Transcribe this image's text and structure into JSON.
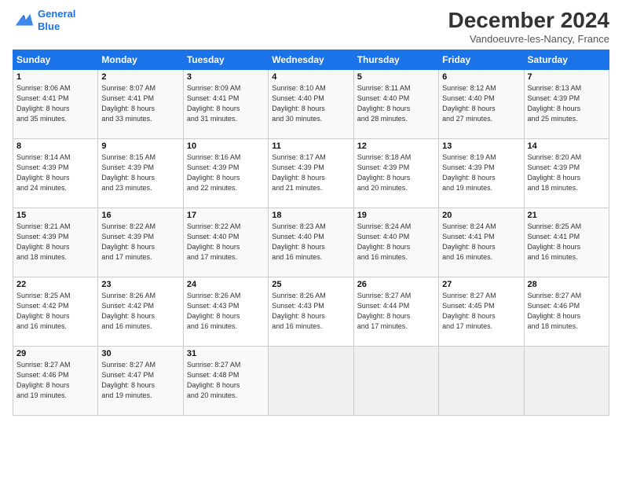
{
  "header": {
    "logo_line1": "General",
    "logo_line2": "Blue",
    "title": "December 2024",
    "subtitle": "Vandoeuvre-les-Nancy, France"
  },
  "weekdays": [
    "Sunday",
    "Monday",
    "Tuesday",
    "Wednesday",
    "Thursday",
    "Friday",
    "Saturday"
  ],
  "weeks": [
    [
      {
        "day": "1",
        "sunrise": "Sunrise: 8:06 AM",
        "sunset": "Sunset: 4:41 PM",
        "daylight": "Daylight: 8 hours and 35 minutes."
      },
      {
        "day": "2",
        "sunrise": "Sunrise: 8:07 AM",
        "sunset": "Sunset: 4:41 PM",
        "daylight": "Daylight: 8 hours and 33 minutes."
      },
      {
        "day": "3",
        "sunrise": "Sunrise: 8:09 AM",
        "sunset": "Sunset: 4:41 PM",
        "daylight": "Daylight: 8 hours and 31 minutes."
      },
      {
        "day": "4",
        "sunrise": "Sunrise: 8:10 AM",
        "sunset": "Sunset: 4:40 PM",
        "daylight": "Daylight: 8 hours and 30 minutes."
      },
      {
        "day": "5",
        "sunrise": "Sunrise: 8:11 AM",
        "sunset": "Sunset: 4:40 PM",
        "daylight": "Daylight: 8 hours and 28 minutes."
      },
      {
        "day": "6",
        "sunrise": "Sunrise: 8:12 AM",
        "sunset": "Sunset: 4:40 PM",
        "daylight": "Daylight: 8 hours and 27 minutes."
      },
      {
        "day": "7",
        "sunrise": "Sunrise: 8:13 AM",
        "sunset": "Sunset: 4:39 PM",
        "daylight": "Daylight: 8 hours and 25 minutes."
      }
    ],
    [
      {
        "day": "8",
        "sunrise": "Sunrise: 8:14 AM",
        "sunset": "Sunset: 4:39 PM",
        "daylight": "Daylight: 8 hours and 24 minutes."
      },
      {
        "day": "9",
        "sunrise": "Sunrise: 8:15 AM",
        "sunset": "Sunset: 4:39 PM",
        "daylight": "Daylight: 8 hours and 23 minutes."
      },
      {
        "day": "10",
        "sunrise": "Sunrise: 8:16 AM",
        "sunset": "Sunset: 4:39 PM",
        "daylight": "Daylight: 8 hours and 22 minutes."
      },
      {
        "day": "11",
        "sunrise": "Sunrise: 8:17 AM",
        "sunset": "Sunset: 4:39 PM",
        "daylight": "Daylight: 8 hours and 21 minutes."
      },
      {
        "day": "12",
        "sunrise": "Sunrise: 8:18 AM",
        "sunset": "Sunset: 4:39 PM",
        "daylight": "Daylight: 8 hours and 20 minutes."
      },
      {
        "day": "13",
        "sunrise": "Sunrise: 8:19 AM",
        "sunset": "Sunset: 4:39 PM",
        "daylight": "Daylight: 8 hours and 19 minutes."
      },
      {
        "day": "14",
        "sunrise": "Sunrise: 8:20 AM",
        "sunset": "Sunset: 4:39 PM",
        "daylight": "Daylight: 8 hours and 18 minutes."
      }
    ],
    [
      {
        "day": "15",
        "sunrise": "Sunrise: 8:21 AM",
        "sunset": "Sunset: 4:39 PM",
        "daylight": "Daylight: 8 hours and 18 minutes."
      },
      {
        "day": "16",
        "sunrise": "Sunrise: 8:22 AM",
        "sunset": "Sunset: 4:39 PM",
        "daylight": "Daylight: 8 hours and 17 minutes."
      },
      {
        "day": "17",
        "sunrise": "Sunrise: 8:22 AM",
        "sunset": "Sunset: 4:40 PM",
        "daylight": "Daylight: 8 hours and 17 minutes."
      },
      {
        "day": "18",
        "sunrise": "Sunrise: 8:23 AM",
        "sunset": "Sunset: 4:40 PM",
        "daylight": "Daylight: 8 hours and 16 minutes."
      },
      {
        "day": "19",
        "sunrise": "Sunrise: 8:24 AM",
        "sunset": "Sunset: 4:40 PM",
        "daylight": "Daylight: 8 hours and 16 minutes."
      },
      {
        "day": "20",
        "sunrise": "Sunrise: 8:24 AM",
        "sunset": "Sunset: 4:41 PM",
        "daylight": "Daylight: 8 hours and 16 minutes."
      },
      {
        "day": "21",
        "sunrise": "Sunrise: 8:25 AM",
        "sunset": "Sunset: 4:41 PM",
        "daylight": "Daylight: 8 hours and 16 minutes."
      }
    ],
    [
      {
        "day": "22",
        "sunrise": "Sunrise: 8:25 AM",
        "sunset": "Sunset: 4:42 PM",
        "daylight": "Daylight: 8 hours and 16 minutes."
      },
      {
        "day": "23",
        "sunrise": "Sunrise: 8:26 AM",
        "sunset": "Sunset: 4:42 PM",
        "daylight": "Daylight: 8 hours and 16 minutes."
      },
      {
        "day": "24",
        "sunrise": "Sunrise: 8:26 AM",
        "sunset": "Sunset: 4:43 PM",
        "daylight": "Daylight: 8 hours and 16 minutes."
      },
      {
        "day": "25",
        "sunrise": "Sunrise: 8:26 AM",
        "sunset": "Sunset: 4:43 PM",
        "daylight": "Daylight: 8 hours and 16 minutes."
      },
      {
        "day": "26",
        "sunrise": "Sunrise: 8:27 AM",
        "sunset": "Sunset: 4:44 PM",
        "daylight": "Daylight: 8 hours and 17 minutes."
      },
      {
        "day": "27",
        "sunrise": "Sunrise: 8:27 AM",
        "sunset": "Sunset: 4:45 PM",
        "daylight": "Daylight: 8 hours and 17 minutes."
      },
      {
        "day": "28",
        "sunrise": "Sunrise: 8:27 AM",
        "sunset": "Sunset: 4:46 PM",
        "daylight": "Daylight: 8 hours and 18 minutes."
      }
    ],
    [
      {
        "day": "29",
        "sunrise": "Sunrise: 8:27 AM",
        "sunset": "Sunset: 4:46 PM",
        "daylight": "Daylight: 8 hours and 19 minutes."
      },
      {
        "day": "30",
        "sunrise": "Sunrise: 8:27 AM",
        "sunset": "Sunset: 4:47 PM",
        "daylight": "Daylight: 8 hours and 19 minutes."
      },
      {
        "day": "31",
        "sunrise": "Sunrise: 8:27 AM",
        "sunset": "Sunset: 4:48 PM",
        "daylight": "Daylight: 8 hours and 20 minutes."
      },
      null,
      null,
      null,
      null
    ]
  ]
}
